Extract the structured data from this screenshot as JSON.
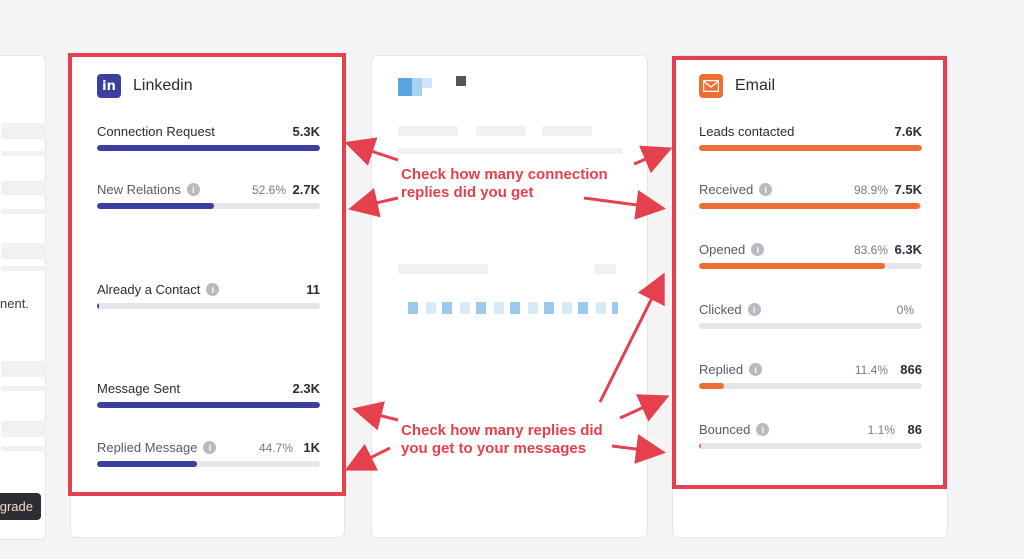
{
  "left_fragment": {
    "text": "nent.",
    "upgrade_label": "grade"
  },
  "linkedin": {
    "badge": "in",
    "title": "Linkedin",
    "metrics": [
      {
        "label": "Connection Request",
        "value": "5.3K",
        "percent": "",
        "fill": 1.0,
        "info": false,
        "muted": false
      },
      {
        "label": "New Relations",
        "value": "2.7K",
        "percent": "52.6%",
        "fill": 0.526,
        "info": true,
        "muted": true
      },
      {
        "label": "Already a Contact",
        "value": "11",
        "percent": "",
        "fill": 0.002,
        "info": true,
        "muted": false
      },
      {
        "label": "Message Sent",
        "value": "2.3K",
        "percent": "",
        "fill": 1.0,
        "info": false,
        "muted": false
      },
      {
        "label": "Replied Message",
        "value": "1K",
        "percent": "44.7%",
        "fill": 0.447,
        "info": true,
        "muted": true
      }
    ]
  },
  "email": {
    "title": "Email",
    "icon": "envelope-icon",
    "metrics": [
      {
        "label": "Leads contacted",
        "value": "7.6K",
        "percent": "",
        "fill": 1.0,
        "info": false,
        "muted": false
      },
      {
        "label": "Received",
        "value": "7.5K",
        "percent": "98.9%",
        "fill": 0.989,
        "info": true,
        "muted": true
      },
      {
        "label": "Opened",
        "value": "6.3K",
        "percent": "83.6%",
        "fill": 0.836,
        "info": true,
        "muted": true
      },
      {
        "label": "Clicked",
        "value": "",
        "percent": "0%",
        "fill": 0.0,
        "info": true,
        "muted": true
      },
      {
        "label": "Replied",
        "value": "866",
        "percent": "11.4%",
        "fill": 0.114,
        "info": true,
        "muted": true
      },
      {
        "label": "Bounced",
        "value": "86",
        "percent": "1.1%",
        "fill": 0.011,
        "info": true,
        "muted": true
      }
    ]
  },
  "annotations": {
    "connections": "Check how many connection replies did you get",
    "messages": "Check how many replies did you get to your messages"
  },
  "colors": {
    "linkedin": "#3b3f9f",
    "email": "#ee6f35",
    "highlight": "#e5404d"
  }
}
